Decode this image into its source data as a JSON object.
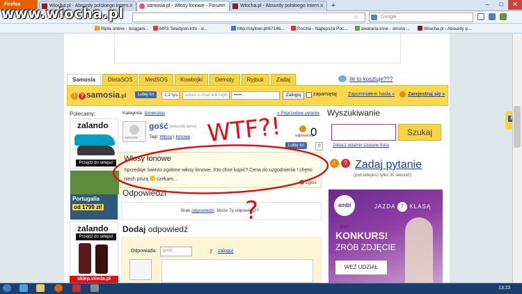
{
  "browser": {
    "app_button": "Firefox",
    "tabs": [
      {
        "label": "Wiocha.pl - Absurdy polskiego intern..."
      },
      {
        "label": "samosia.pl - Włosy łonowe - Forum"
      },
      {
        "label": "Wiocha.pl - Absurdy polskiego intern..."
      }
    ],
    "new_tab": "+",
    "search_placeholder": "Google",
    "bookmarks": [
      {
        "label": "Ripla online - ściągani..."
      },
      {
        "label": "MP3.Teledyski.info - d..."
      },
      {
        "label": "http://stylowi.pl/67146..."
      },
      {
        "label": "Poczta - Najlepsza Poc..."
      },
      {
        "label": "awataria-inne - strona ..."
      },
      {
        "label": "Wiocha.pl - Absurdy p..."
      }
    ],
    "window_min": "–",
    "window_max": "□",
    "window_close": "✕"
  },
  "watermark": "www.wiocha.pl",
  "site": {
    "nav_tabs": [
      "Samosia",
      "DietaSOS",
      "MedSOS",
      "Kowbojki",
      "Demoty",
      "Ryjbuk",
      "Zadaj"
    ],
    "cost_link": "Ile to kosztuje???",
    "logo": "samosia",
    "logo_tld": ".pl",
    "fb_like": "Lubię to!",
    "fb_count": "2,2 tys.",
    "email_placeholder": "adres e-mail lub login",
    "password_value": "•••••",
    "login_button": "Zaloguj",
    "remember": "zapamiętaj",
    "forgot": "Zapomniałem hasła »",
    "register": "Zarejestruj się »"
  },
  "left": {
    "recommend": "Polecamy:",
    "ad1_brand": "zalando",
    "ad1_cta": "Przejdź do sklepu!",
    "ad2_text": "Portugalia",
    "ad2_price": "od 1799 zł!",
    "ad3_brand": "zalando",
    "ad3_cta": "Przejdź do sklepu!",
    "ad4": "sklep.vileda.pl"
  },
  "question": {
    "category_label": "Kategoria:",
    "category": "Ginekolog",
    "prev": "« Poprzednie pytanie",
    "author": "gość",
    "author_meta": "[sekundę temu]",
    "tags_label": "Tagi:",
    "tag1": "Włosy",
    "tag2": "łonowe",
    "answers_label": "odpowiedzi:",
    "answers_count": "0",
    "fb_like": "Lubię to!",
    "fb_count": "0",
    "title": "Włosy łonowe",
    "body": "Sprzedaje świeżo zgolone włosy łonowe. Kto chce kupić? Cena do uzgodnienia ! chętni niech piszą",
    "body_end": "czekam...",
    "report": "Zgłoś",
    "avatar_text": "samosia"
  },
  "answers": {
    "heading": "Odpowiedzi",
    "empty_pre": "Brak",
    "empty_link": "odpowiedzi",
    "empty_post": ". Może Ty odpowiesz?"
  },
  "form": {
    "heading_a": "Dodaj",
    "heading_b": "odpowiedź",
    "label": "Odpowiada:",
    "name_value": "gość",
    "login_link": "zaloguj"
  },
  "right": {
    "search_heading": "Wyszukiwanie",
    "search_button": "Szukaj",
    "last_searches": "Zobacz ostatnio szukane frazy",
    "ask_heading": "Zadaj pytanie",
    "ask_sub": "(potrzebujesz tylko 30 sekund!)",
    "ad_brand": "ambi pur",
    "ad_tagline_a": "JAZDA",
    "ad_tagline_n": "7",
    "ad_tagline_b": "KLASĄ",
    "ad_contest": "KONKURS!",
    "ad_sub": "ZRÓB ZDJĘCIE",
    "ad_cta": "WEŹ UDZIAŁ"
  },
  "annotations": {
    "wtf": "WTF?!",
    "qmark": "?"
  },
  "taskbar": {
    "clock": "13:22"
  }
}
